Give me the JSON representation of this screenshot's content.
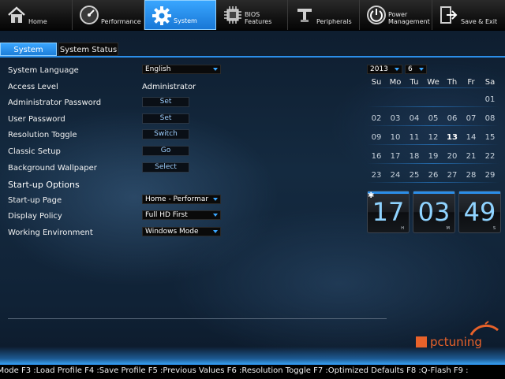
{
  "menu": {
    "tabs": [
      {
        "label": "Home",
        "icon": "house-icon",
        "active": false
      },
      {
        "label": "Performance",
        "icon": "gauge-icon",
        "active": false
      },
      {
        "label": "System",
        "icon": "gear-icon",
        "active": true
      },
      {
        "label": "BIOS\nFeatures",
        "icon": "chip-icon",
        "active": false
      },
      {
        "label": "Peripherals",
        "icon": "connector-icon",
        "active": false
      },
      {
        "label": "Power\nManagement",
        "icon": "power-icon",
        "active": false
      },
      {
        "label": "Save & Exit",
        "icon": "exit-icon",
        "active": false
      }
    ]
  },
  "subtabs": {
    "system": "System",
    "status": "System Status"
  },
  "settings": {
    "language_label": "System Language",
    "language_value": "English",
    "access_label": "Access Level",
    "access_value": "Administrator",
    "admin_pw_label": "Administrator Password",
    "admin_pw_button": "Set",
    "user_pw_label": "User Password",
    "user_pw_button": "Set",
    "res_toggle_label": "Resolution Toggle",
    "res_toggle_button": "Switch",
    "classic_label": "Classic Setup",
    "classic_button": "Go",
    "wallpaper_label": "Background Wallpaper",
    "wallpaper_button": "Select",
    "startup_section": "Start-up Options",
    "startup_page_label": "Start-up Page",
    "startup_page_value": "Home - Performar",
    "display_policy_label": "Display Policy",
    "display_policy_value": "Full HD First",
    "work_env_label": "Working Environment",
    "work_env_value": "Windows Mode"
  },
  "calendar": {
    "year": "2013",
    "month": "6",
    "weekdays": [
      "Su",
      "Mo",
      "Tu",
      "We",
      "Th",
      "Fr",
      "Sa"
    ],
    "weeks": [
      [
        "",
        "",
        "",
        "",
        "",
        "",
        "01"
      ],
      [
        "02",
        "03",
        "04",
        "05",
        "06",
        "07",
        "08"
      ],
      [
        "09",
        "10",
        "11",
        "12",
        "13",
        "14",
        "15"
      ],
      [
        "16",
        "17",
        "18",
        "19",
        "20",
        "21",
        "22"
      ],
      [
        "23",
        "24",
        "25",
        "26",
        "27",
        "28",
        "29"
      ]
    ],
    "today": "13"
  },
  "clock": {
    "hours": "17",
    "minutes": "03",
    "seconds": "49",
    "hours_unit": "H",
    "minutes_unit": "M",
    "seconds_unit": "S",
    "accent": "#8fd3ff"
  },
  "footer": {
    "hotkeys": ": Mode F3 :Load Profile F4 :Save Profile F5 :Previous Values F6 :Resolution Toggle F7 :Optimized Defaults F8 :Q-Flash F9 :"
  },
  "logo": {
    "text": "pctuning",
    "accent": "#e8622a"
  }
}
